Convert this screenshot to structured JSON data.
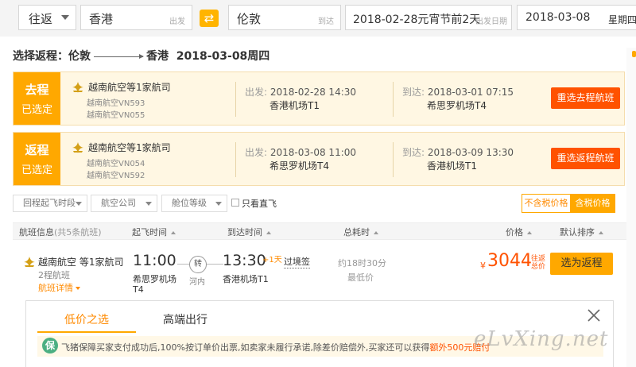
{
  "search": {
    "trip_type": "往返",
    "from_city": "香港",
    "from_hint": "出发",
    "to_city": "伦敦",
    "to_hint": "到达",
    "depart_date": "2018-02-28元宵节前2天",
    "depart_hint": "出发日期",
    "return_date": "2018-03-08",
    "return_weekday": "星期四",
    "swap_icon": "swap-icon"
  },
  "heading": {
    "prefix": "选择返程：伦敦",
    "dest": "香港",
    "date": "2018-03-08周四"
  },
  "outbound": {
    "tag_title": "去程",
    "tag_sub": "已选定",
    "airline": "越南航空等1家航司",
    "flight1": "越南航空VN593",
    "flight2": "越南航空VN055",
    "dep_label": "出发:",
    "dep_time": "2018-02-28 14:30",
    "dep_airport": "香港机场T1",
    "arr_label": "到达:",
    "arr_time": "2018-03-01 07:15",
    "arr_airport": "希思罗机场T4",
    "button": "重选去程航班"
  },
  "return_selected": {
    "tag_title": "返程",
    "tag_sub": "已选定",
    "airline": "越南航空等1家航司",
    "flight1": "越南航空VN054",
    "flight2": "越南航空VN592",
    "dep_label": "出发:",
    "dep_time": "2018-03-08 11:00",
    "dep_airport": "希思罗机场T4",
    "arr_label": "到达:",
    "arr_time": "2018-03-09 13:30",
    "arr_airport": "香港机场T1",
    "button": "重选返程航班"
  },
  "filters": {
    "depart_time": "回程起飞时段",
    "airline": "航空公司",
    "cabin": "舱位等级",
    "direct_only": "只看直飞",
    "price_excl_tax": "不含税价格",
    "price_incl_tax": "含税价格"
  },
  "list_header": {
    "flight_info": "航班信息",
    "flight_count": "(共5条航班)",
    "depart_time": "起飞时间",
    "arrive_time": "到达时间",
    "duration": "总耗时",
    "price": "价格",
    "sort": "默认排序"
  },
  "result": {
    "airline": "越南航空 等1家航司",
    "legs": "2程航班",
    "details": "航班详情",
    "dep_time": "11:00",
    "dep_airport": "希思罗机场",
    "dep_terminal": "T4",
    "transfer": "转",
    "transfer_city": "河内",
    "arr_time": "13:30",
    "plus_day": "+1天",
    "transit_visa": "过境签",
    "arr_airport": "香港机场T1",
    "duration": "约18时30分",
    "lowest": "最低价",
    "currency": "¥",
    "price": "3044",
    "tax_note": "往返总价",
    "select": "选为返程"
  },
  "panel": {
    "tab_low": "低价之选",
    "tab_high": "高端出行",
    "notice_icon": "保",
    "notice_text": "飞猪保障买家支付成功后,100%按订单价出票,如卖家未履行承诺,除差价赔偿外,买家还可以获得",
    "notice_highlight": "额外500元赔付"
  },
  "watermark": "eLvXing.net",
  "colors": {
    "accent_orange": "#ffa800",
    "button_red": "#ff5200",
    "card_bg": "#fff7e3",
    "price_red": "#ff5200"
  }
}
